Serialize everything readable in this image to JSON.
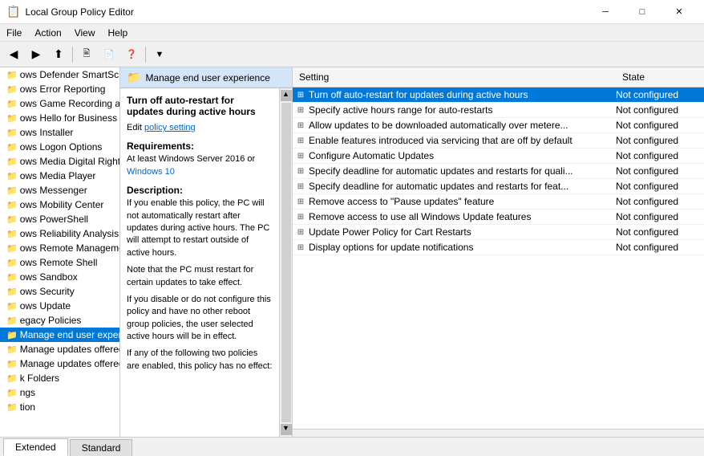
{
  "titleBar": {
    "icon": "📋",
    "title": "Local Group Policy Editor",
    "controls": {
      "minimize": "─",
      "maximize": "□",
      "close": "✕"
    }
  },
  "menuBar": {
    "items": [
      "File",
      "Action",
      "View",
      "Help"
    ]
  },
  "toolbar": {
    "buttons": [
      "◀",
      "▶",
      "⬆",
      "📋",
      "🗎",
      "📄",
      "❓",
      "⬛",
      "🔽"
    ]
  },
  "sidebar": {
    "items": [
      {
        "label": "ows Defender SmartScre",
        "icon": "📁",
        "selected": false
      },
      {
        "label": "ows Error Reporting",
        "icon": "📁",
        "selected": false
      },
      {
        "label": "ows Game Recording an",
        "icon": "📁",
        "selected": false
      },
      {
        "label": "ows Hello for Business",
        "icon": "📁",
        "selected": false
      },
      {
        "label": "ows Installer",
        "icon": "📁",
        "selected": false
      },
      {
        "label": "ows Logon Options",
        "icon": "📁",
        "selected": false
      },
      {
        "label": "ows Media Digital Right:",
        "icon": "📁",
        "selected": false
      },
      {
        "label": "ows Media Player",
        "icon": "📁",
        "selected": false
      },
      {
        "label": "ows Messenger",
        "icon": "📁",
        "selected": false
      },
      {
        "label": "ows Mobility Center",
        "icon": "📁",
        "selected": false
      },
      {
        "label": "ows PowerShell",
        "icon": "📁",
        "selected": false
      },
      {
        "label": "ows Reliability Analysis",
        "icon": "📁",
        "selected": false
      },
      {
        "label": "ows Remote Manageme",
        "icon": "📁",
        "selected": false
      },
      {
        "label": "ows Remote Shell",
        "icon": "📁",
        "selected": false
      },
      {
        "label": "ows Sandbox",
        "icon": "📁",
        "selected": false
      },
      {
        "label": "ows Security",
        "icon": "📁",
        "selected": false
      },
      {
        "label": "ows Update",
        "icon": "📁",
        "selected": false
      },
      {
        "label": "egacy Policies",
        "icon": "📁",
        "selected": false
      },
      {
        "label": "Manage end user experie",
        "icon": "📁",
        "selected": true
      },
      {
        "label": "Manage updates offered f",
        "icon": "📁",
        "selected": false
      },
      {
        "label": "Manage updates offered f",
        "icon": "📁",
        "selected": false
      },
      {
        "label": "k Folders",
        "icon": "📁",
        "selected": false
      },
      {
        "label": "ngs",
        "icon": "📁",
        "selected": false
      },
      {
        "label": "tion",
        "icon": "📁",
        "selected": false
      }
    ]
  },
  "folderHeader": {
    "icon": "📁",
    "title": "Manage end user experience"
  },
  "policyDetail": {
    "title": "Turn off auto-restart for updates during active hours",
    "linkText": "policy setting",
    "requirementsLabel": "Requirements:",
    "requirementsText": "At least Windows Server 2016 or Windows 10",
    "descriptionLabel": "Description:",
    "descriptionText": "If you enable this policy, the PC will not automatically restart after updates during active hours. The PC will attempt to restart outside of active hours.",
    "noteText": "Note that the PC must restart for certain updates to take effect.",
    "disableText": "If you disable or do not configure this policy and have no other reboot group policies, the user selected active hours will be in effect.",
    "ifAnyText": "If any of the following two policies are enabled, this policy has no effect:"
  },
  "settingsTable": {
    "columns": [
      "Setting",
      "State"
    ],
    "rows": [
      {
        "name": "Turn off auto-restart for updates during active hours",
        "state": "Not configured",
        "selected": true
      },
      {
        "name": "Specify active hours range for auto-restarts",
        "state": "Not configured",
        "selected": false
      },
      {
        "name": "Allow updates to be downloaded automatically over metere...",
        "state": "Not configured",
        "selected": false
      },
      {
        "name": "Enable features introduced via servicing that are off by default",
        "state": "Not configured",
        "selected": false
      },
      {
        "name": "Configure Automatic Updates",
        "state": "Not configured",
        "selected": false
      },
      {
        "name": "Specify deadline for automatic updates and restarts for quali...",
        "state": "Not configured",
        "selected": false
      },
      {
        "name": "Specify deadline for automatic updates and restarts for feat...",
        "state": "Not configured",
        "selected": false
      },
      {
        "name": "Remove access to \"Pause updates\" feature",
        "state": "Not configured",
        "selected": false
      },
      {
        "name": "Remove access to use all Windows Update features",
        "state": "Not configured",
        "selected": false
      },
      {
        "name": "Update Power Policy for Cart Restarts",
        "state": "Not configured",
        "selected": false
      },
      {
        "name": "Display options for update notifications",
        "state": "Not configured",
        "selected": false
      }
    ]
  },
  "tabs": [
    {
      "label": "Extended",
      "active": true
    },
    {
      "label": "Standard",
      "active": false
    }
  ]
}
